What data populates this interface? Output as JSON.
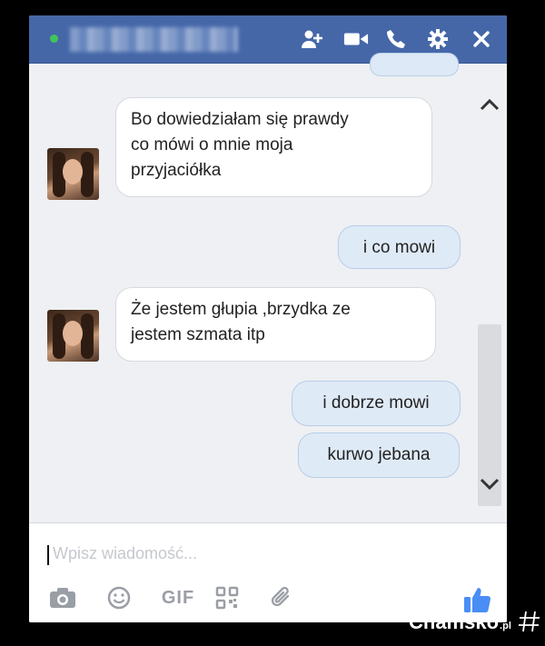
{
  "header": {
    "contact_name": "",
    "icons": [
      "add-person-icon",
      "video-call-icon",
      "phone-icon",
      "settings-icon",
      "close-icon"
    ],
    "online_color": "#42c35a",
    "bar_color": "#4567a8"
  },
  "messages": [
    {
      "from": "contact",
      "text": "Bo dowiedziałam się prawdy co mówi o mnie moja przyjaciółka",
      "lines": [
        "Bo dowiedziałam się prawdy",
        "co mówi o mnie moja",
        "przyjaciółka"
      ]
    },
    {
      "from": "me",
      "text": "i co mowi"
    },
    {
      "from": "contact",
      "text": "Że jestem głupia ,brzydka ze jestem szmata itp",
      "lines": [
        "Że jestem głupia ,brzydka ze",
        "jestem szmata itp"
      ]
    },
    {
      "from": "me",
      "text": "i dobrze mowi"
    },
    {
      "from": "me",
      "text": "kurwo jebana"
    }
  ],
  "composer": {
    "placeholder": "Wpisz wiadomość...",
    "tools": [
      "camera-icon",
      "emoji-icon",
      "gif-button",
      "qr-code-icon",
      "attachment-icon",
      "like-icon"
    ],
    "gif_label": "GIF"
  },
  "watermark": {
    "name": "Chamsko",
    "tld": ".pl"
  }
}
